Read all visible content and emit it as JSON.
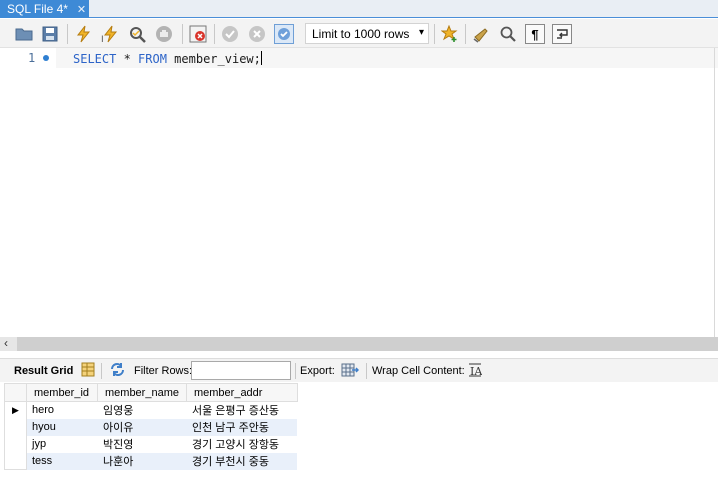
{
  "tab": {
    "title": "SQL File 4*",
    "close": "✕"
  },
  "toolbar": {
    "limit_label": "Limit to 1000 rows"
  },
  "editor": {
    "line_number": "1",
    "tokens": {
      "select": "SELECT",
      "star": " * ",
      "from": "FROM",
      "ident": " member_view;"
    }
  },
  "result_toolbar": {
    "result_grid": "Result Grid",
    "filter_rows": "Filter Rows:",
    "filter_value": "",
    "export": "Export:",
    "wrap": "Wrap Cell Content:"
  },
  "grid": {
    "columns": [
      "member_id",
      "member_name",
      "member_addr"
    ],
    "rows": [
      [
        "hero",
        "임영웅",
        "서울 은평구 증산동"
      ],
      [
        "hyou",
        "아이유",
        "인천 남구 주안동"
      ],
      [
        "jyp",
        "박진영",
        "경기 고양시 장항동"
      ],
      [
        "tess",
        "나훈아",
        "경기 부천시 중동"
      ]
    ],
    "current_row_marker": "▶"
  },
  "colors": {
    "tab_accent": "#3e8ad6",
    "keyword": "#2d64c8",
    "alt_row": "#e9f0fa"
  }
}
